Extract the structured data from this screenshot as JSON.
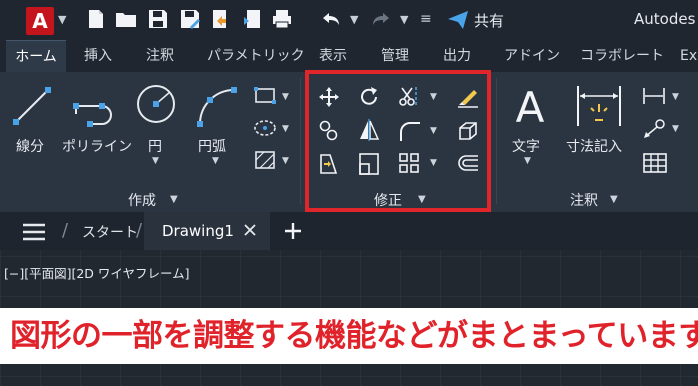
{
  "qat": {
    "app_letter": "A",
    "share_label": "共有",
    "app_title": "Autodes"
  },
  "ribbon_tabs": [
    "ホーム",
    "挿入",
    "注釈",
    "パラメトリック",
    "表示",
    "管理",
    "出力",
    "アドイン",
    "コラボレート",
    "Ex"
  ],
  "draw_panel": {
    "line": "線分",
    "polyline": "ポリライン",
    "circle": "円",
    "arc": "円弧",
    "title": "作成"
  },
  "modify_panel": {
    "title": "修正"
  },
  "annotation_panel": {
    "text": "文字",
    "dimension": "寸法記入",
    "title": "注釈"
  },
  "doc_tabs": {
    "start": "スタート",
    "drawing": "Drawing1"
  },
  "viewport_label": "[−][平面図][2D ワイヤフレーム]",
  "callout": "図形の一部を調整する機能などがまとまっています",
  "colors": {
    "highlight": "#e0262a",
    "accent": "#c4151c",
    "icon_blue": "#4aa3e8"
  }
}
